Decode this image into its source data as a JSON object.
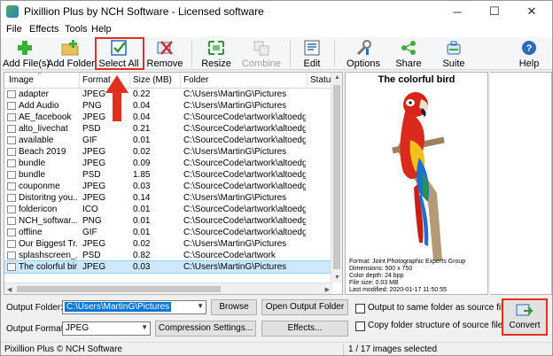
{
  "window": {
    "title": "Pixillion Plus by NCH Software - Licensed software",
    "minimize_glyph": "─",
    "maximize_glyph": "☐",
    "close_glyph": "✕"
  },
  "menu": [
    "File",
    "Effects",
    "Tools",
    "Help"
  ],
  "toolbar": {
    "add_files": "Add File(s)",
    "add_folder": "Add Folder",
    "select_all": "Select All",
    "remove": "Remove",
    "resize": "Resize",
    "combine": "Combine",
    "edit": "Edit",
    "options": "Options",
    "share": "Share",
    "suite": "Suite",
    "help": "Help"
  },
  "table": {
    "columns": [
      "Image",
      "Format",
      "Size (MB)",
      "Folder",
      "Status"
    ],
    "rows": [
      {
        "name": "adapter",
        "format": "JPEG",
        "size": "0.22",
        "folder": "C:\\Users\\MartinG\\Pictures"
      },
      {
        "name": "Add Audio",
        "format": "PNG",
        "size": "0.04",
        "folder": "C:\\Users\\MartinG\\Pictures"
      },
      {
        "name": "AE_facebook",
        "format": "JPEG",
        "size": "0.04",
        "folder": "C:\\SourceCode\\artwork\\altoedg..."
      },
      {
        "name": "alto_livechat",
        "format": "PSD",
        "size": "0.21",
        "folder": "C:\\SourceCode\\artwork\\altoedg..."
      },
      {
        "name": "available",
        "format": "GIF",
        "size": "0.01",
        "folder": "C:\\SourceCode\\artwork\\altoedg..."
      },
      {
        "name": "Beach 2019",
        "format": "JPEG",
        "size": "0.02",
        "folder": "C:\\Users\\MartinG\\Pictures"
      },
      {
        "name": "bundle",
        "format": "JPEG",
        "size": "0.09",
        "folder": "C:\\SourceCode\\artwork\\altoedg..."
      },
      {
        "name": "bundle",
        "format": "PSD",
        "size": "1.85",
        "folder": "C:\\SourceCode\\artwork\\altoedg..."
      },
      {
        "name": "couponme",
        "format": "JPEG",
        "size": "0.03",
        "folder": "C:\\SourceCode\\artwork\\altoedg..."
      },
      {
        "name": "Distoritng you...",
        "format": "JPEG",
        "size": "0.14",
        "folder": "C:\\Users\\MartinG\\Pictures"
      },
      {
        "name": "foldericon",
        "format": "ICO",
        "size": "0.01",
        "folder": "C:\\SourceCode\\artwork\\altoedg..."
      },
      {
        "name": "NCH_softwar...",
        "format": "PNG",
        "size": "0.01",
        "folder": "C:\\SourceCode\\artwork\\altoedg..."
      },
      {
        "name": "offline",
        "format": "GIF",
        "size": "0.01",
        "folder": "C:\\SourceCode\\artwork\\altoedg..."
      },
      {
        "name": "Our Biggest Tr...",
        "format": "JPEG",
        "size": "0.02",
        "folder": "C:\\Users\\MartinG\\Pictures"
      },
      {
        "name": "splashscreen_...",
        "format": "PSD",
        "size": "0.82",
        "folder": "C:\\SourceCode\\artwork"
      },
      {
        "name": "The colorful bird",
        "format": "JPEG",
        "size": "0.03",
        "folder": "C:\\Users\\MartinG\\Pictures"
      }
    ],
    "selected_index": 15
  },
  "preview": {
    "title": "The colorful bird",
    "meta": [
      "Format: Joint Photographic Experts Group",
      "Dimensions: 500 x 750",
      "Color depth: 24 bpp",
      "File size: 0.03 MB",
      "Last modified: 2020-01-17 11:50:55"
    ]
  },
  "output": {
    "folder_label": "Output Folder:",
    "folder_value": "C:\\Users\\MartinG\\Pictures",
    "browse": "Browse",
    "open_output_folder": "Open Output Folder",
    "format_label": "Output Format:",
    "format_value": "JPEG",
    "compression_settings": "Compression Settings...",
    "effects": "Effects...",
    "same_folder": "Output to same folder as source files",
    "copy_structure": "Copy folder structure of source files",
    "convert": "Convert"
  },
  "status": {
    "left": "Pixillion Plus © NCH Software",
    "right": "1 / 17 images selected"
  },
  "colors": {
    "highlight_red": "#e0301e",
    "selection": "#cde8ff",
    "accent": "#0078d7"
  }
}
